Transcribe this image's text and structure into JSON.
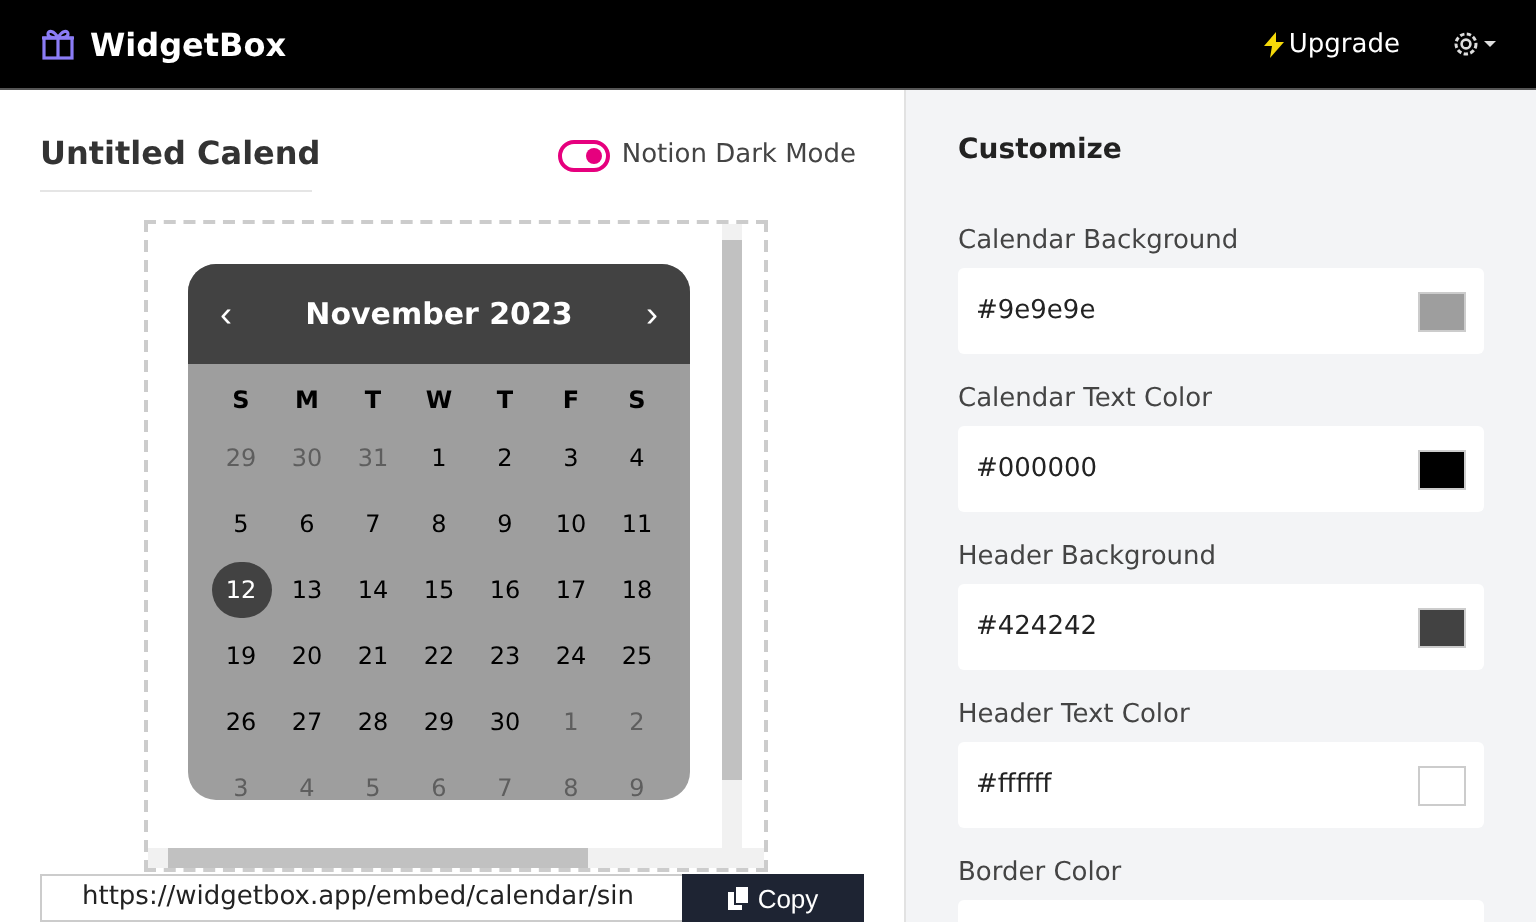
{
  "topbar": {
    "brand": "WidgetBox",
    "upgrade": "Upgrade"
  },
  "editor": {
    "title": "Untitled Calend",
    "dark_mode": {
      "label": "Notion Dark Mode",
      "on": true
    }
  },
  "calendar": {
    "month": "November 2023",
    "prev": "‹",
    "next": "›",
    "weekdays": [
      "S",
      "M",
      "T",
      "W",
      "T",
      "F",
      "S"
    ],
    "weeks": [
      [
        {
          "day": "29",
          "muted": true,
          "selected": false
        },
        {
          "day": "30",
          "muted": true,
          "selected": false
        },
        {
          "day": "31",
          "muted": true,
          "selected": false
        },
        {
          "day": "1",
          "muted": false,
          "selected": false
        },
        {
          "day": "2",
          "muted": false,
          "selected": false
        },
        {
          "day": "3",
          "muted": false,
          "selected": false
        },
        {
          "day": "4",
          "muted": false,
          "selected": false
        }
      ],
      [
        {
          "day": "5",
          "muted": false,
          "selected": false
        },
        {
          "day": "6",
          "muted": false,
          "selected": false
        },
        {
          "day": "7",
          "muted": false,
          "selected": false
        },
        {
          "day": "8",
          "muted": false,
          "selected": false
        },
        {
          "day": "9",
          "muted": false,
          "selected": false
        },
        {
          "day": "10",
          "muted": false,
          "selected": false
        },
        {
          "day": "11",
          "muted": false,
          "selected": false
        }
      ],
      [
        {
          "day": "12",
          "muted": false,
          "selected": true
        },
        {
          "day": "13",
          "muted": false,
          "selected": false
        },
        {
          "day": "14",
          "muted": false,
          "selected": false
        },
        {
          "day": "15",
          "muted": false,
          "selected": false
        },
        {
          "day": "16",
          "muted": false,
          "selected": false
        },
        {
          "day": "17",
          "muted": false,
          "selected": false
        },
        {
          "day": "18",
          "muted": false,
          "selected": false
        }
      ],
      [
        {
          "day": "19",
          "muted": false,
          "selected": false
        },
        {
          "day": "20",
          "muted": false,
          "selected": false
        },
        {
          "day": "21",
          "muted": false,
          "selected": false
        },
        {
          "day": "22",
          "muted": false,
          "selected": false
        },
        {
          "day": "23",
          "muted": false,
          "selected": false
        },
        {
          "day": "24",
          "muted": false,
          "selected": false
        },
        {
          "day": "25",
          "muted": false,
          "selected": false
        }
      ],
      [
        {
          "day": "26",
          "muted": false,
          "selected": false
        },
        {
          "day": "27",
          "muted": false,
          "selected": false
        },
        {
          "day": "28",
          "muted": false,
          "selected": false
        },
        {
          "day": "29",
          "muted": false,
          "selected": false
        },
        {
          "day": "30",
          "muted": false,
          "selected": false
        },
        {
          "day": "1",
          "muted": true,
          "selected": false
        },
        {
          "day": "2",
          "muted": true,
          "selected": false
        }
      ],
      [
        {
          "day": "3",
          "muted": true,
          "selected": false
        },
        {
          "day": "4",
          "muted": true,
          "selected": false
        },
        {
          "day": "5",
          "muted": true,
          "selected": false
        },
        {
          "day": "6",
          "muted": true,
          "selected": false
        },
        {
          "day": "7",
          "muted": true,
          "selected": false
        },
        {
          "day": "8",
          "muted": true,
          "selected": false
        },
        {
          "day": "9",
          "muted": true,
          "selected": false
        }
      ]
    ]
  },
  "embed": {
    "url": "https://widgetbox.app/embed/calendar/sin",
    "copy": "Copy"
  },
  "customize": {
    "title": "Customize",
    "fields": [
      {
        "label": "Calendar Background",
        "value": "#9e9e9e",
        "color": "#9e9e9e"
      },
      {
        "label": "Calendar Text Color",
        "value": "#000000",
        "color": "#000000"
      },
      {
        "label": "Header Background",
        "value": "#424242",
        "color": "#424242"
      },
      {
        "label": "Header Text Color",
        "value": "#ffffff",
        "color": "#ffffff"
      },
      {
        "label": "Border Color"
      }
    ]
  }
}
